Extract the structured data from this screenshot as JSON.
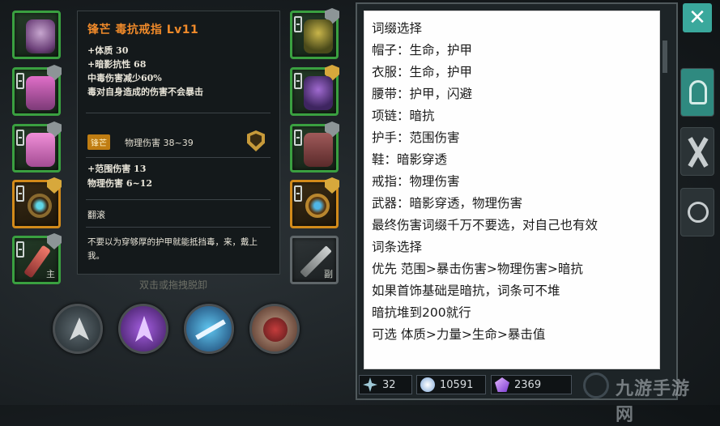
{
  "tooltip": {
    "title": "锋芒  毒抗戒指  Lv11",
    "stats": [
      "+体质 30",
      "+暗影抗性 68",
      "中毒伤害减少60%",
      "毒对自身造成的伤害不会暴击"
    ],
    "badge": "锋芒",
    "badge_stat": "物理伤害 38~39",
    "bonus": [
      "+范围伤害 13",
      "物理伤害 6~12"
    ],
    "skill": "翻滚",
    "flavor": "不要以为穿够厚的护甲就能抵挡毒，来，戴上我。"
  },
  "hint": "双击或拖拽脱卸",
  "slot_tags": {
    "weapon_left": "主",
    "weapon_right": "副"
  },
  "note": {
    "lines": [
      "词缀选择",
      "帽子：生命，护甲",
      "衣服：生命，护甲",
      "腰带：护甲，闪避",
      "项链：暗抗",
      "护手：范围伤害",
      "鞋：暗影穿透",
      "戒指：物理伤害",
      "武器：暗影穿透，物理伤害",
      "最终伤害词缀千万不要选，对自己也有效",
      "词条选择",
      "优先 范围>暴击伤害>物理伤害>暗抗",
      "如果首饰基础是暗抗，词条可不堆",
      "暗抗堆到200就行",
      "可选 体质>力量>生命>暴击值"
    ]
  },
  "resources": {
    "shards": "32",
    "gems": "10591",
    "crystals": "2369"
  },
  "buttons": {
    "close": "✕"
  },
  "watermark": "九游手游网",
  "colors": {
    "rarity_green": "#3aa040",
    "rarity_gold": "#d28a1a",
    "title_orange": "#f08a2a",
    "accent_teal": "#3aa89c"
  }
}
